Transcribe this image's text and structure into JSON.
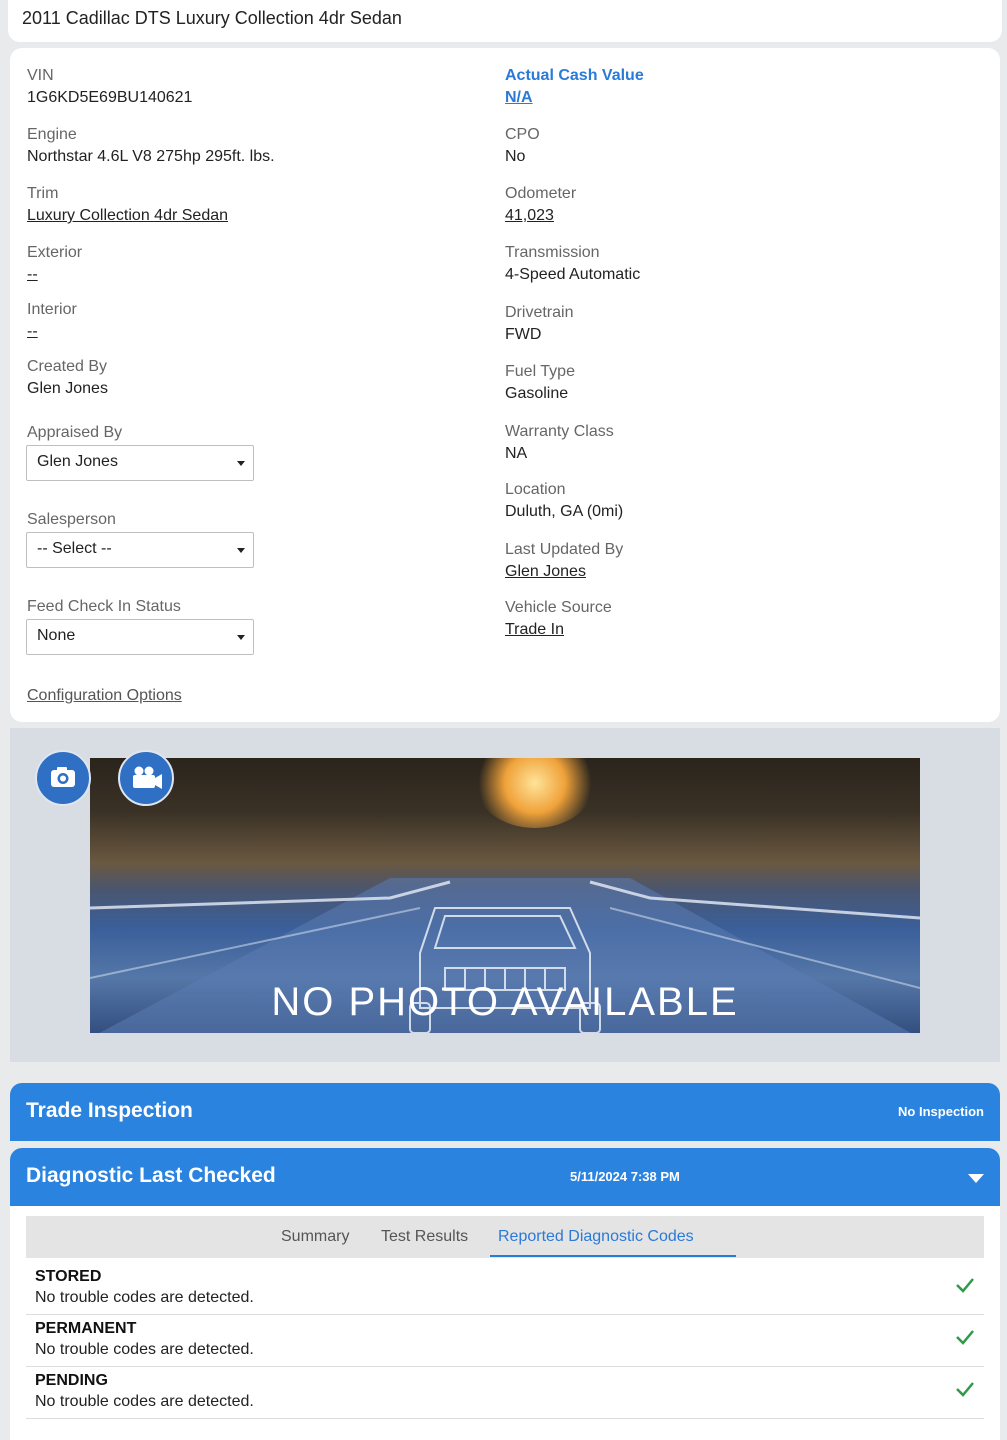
{
  "header": {
    "title": "2011 Cadillac DTS Luxury Collection 4dr Sedan"
  },
  "left": {
    "vin": {
      "label": "VIN",
      "value": "1G6KD5E69BU140621"
    },
    "engine": {
      "label": "Engine",
      "value": "Northstar 4.6L V8 275hp 295ft. lbs."
    },
    "trim": {
      "label": "Trim",
      "value": "Luxury Collection 4dr Sedan"
    },
    "exterior": {
      "label": "Exterior",
      "value": "--"
    },
    "interior": {
      "label": "Interior",
      "value": "--"
    },
    "created_by": {
      "label": "Created By",
      "value": "Glen Jones"
    },
    "appraised_by": {
      "label": "Appraised By",
      "value": "Glen Jones"
    },
    "salesperson": {
      "label": "Salesperson",
      "value": "-- Select --"
    },
    "feed_status": {
      "label": "Feed Check In Status",
      "value": "None"
    },
    "config_link": "Configuration Options"
  },
  "right": {
    "acv": {
      "label": "Actual Cash Value",
      "value": "N/A"
    },
    "cpo": {
      "label": "CPO",
      "value": "No"
    },
    "odometer": {
      "label": "Odometer",
      "value": "41,023"
    },
    "transmission": {
      "label": "Transmission",
      "value": "4-Speed Automatic"
    },
    "drivetrain": {
      "label": "Drivetrain",
      "value": "FWD"
    },
    "fuel": {
      "label": "Fuel Type",
      "value": "Gasoline"
    },
    "warranty": {
      "label": "Warranty Class",
      "value": "NA"
    },
    "location": {
      "label": "Location",
      "value": "Duluth, GA (0mi)"
    },
    "updated_by": {
      "label": "Last Updated By",
      "value": "Glen Jones"
    },
    "source": {
      "label": "Vehicle Source",
      "value": "Trade In"
    }
  },
  "photo": {
    "placeholder_text": "NO PHOTO AVAILABLE",
    "camera_icon": "camera-icon",
    "video_icon": "video-camera-icon"
  },
  "trade_inspection": {
    "title": "Trade Inspection",
    "status": "No Inspection"
  },
  "diagnostic": {
    "title": "Diagnostic Last Checked",
    "timestamp": "5/11/2024 7:38 PM",
    "tabs": [
      "Summary",
      "Test Results",
      "Reported Diagnostic Codes"
    ],
    "active_tab": "Reported Diagnostic Codes",
    "codes": [
      {
        "type": "STORED",
        "message": "No trouble codes are detected."
      },
      {
        "type": "PERMANENT",
        "message": "No trouble codes are detected."
      },
      {
        "type": "PENDING",
        "message": "No trouble codes are detected."
      }
    ]
  },
  "colors": {
    "accent": "#2b83e0",
    "link_blue": "#2a7ad8",
    "check_green": "#2e9b48"
  }
}
